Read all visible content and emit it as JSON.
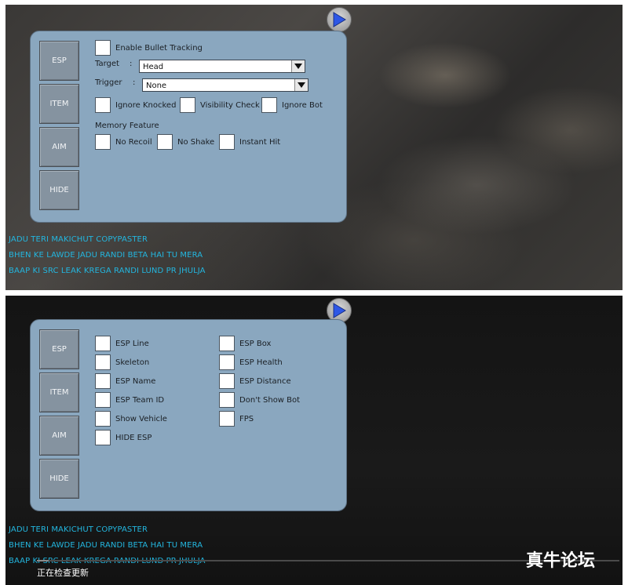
{
  "screens": [
    {
      "tabs": [
        "ESP",
        "ITEM",
        "AIM",
        "HIDE"
      ],
      "aim_panel": {
        "enable_bullet_tracking": "Enable Bullet Tracking",
        "target_label": "Target",
        "target_value": "Head",
        "trigger_label": "Trigger",
        "trigger_value": "None",
        "ignore_knocked": "Ignore Knocked",
        "visibility_check": "Visibility Check",
        "ignore_bot": "Ignore Bot",
        "memory_feature_label": "Memory Feature",
        "no_recoil": "No Recoil",
        "no_shake": "No Shake",
        "instant_hit": "Instant Hit"
      },
      "banner": [
        "JADU TERI MAKICHUT COPYPASTER",
        "BHEN KE LAWDE JADU RANDI BETA HAI TU MERA",
        "BAAP KI SRC LEAK KREGA RANDI LUND PR JHULJA"
      ]
    },
    {
      "tabs": [
        "ESP",
        "ITEM",
        "AIM",
        "HIDE"
      ],
      "esp_panel": {
        "left": [
          "ESP Line",
          "Skeleton",
          "ESP Name",
          "ESP Team ID",
          "Show Vehicle",
          "HIDE ESP"
        ],
        "right": [
          "ESP Box",
          "ESP Health",
          "ESP Distance",
          "Don't Show Bot",
          "FPS"
        ]
      },
      "banner": [
        "JADU TERI MAKICHUT COPYPASTER",
        "BHEN KE LAWDE JADU RANDI BETA HAI TU MERA",
        "BAAP KI SRC LEAK KREGA RANDI LUND PR JHULJA"
      ],
      "status_text": "正在检查更新",
      "progress_fraction": 0.02,
      "watermark": "真牛论坛"
    }
  ],
  "colors": {
    "panel_bg": "#8aa7bf",
    "tab_bg": "#8593a0",
    "banner_text": "#23b6df",
    "toggle_arrow": "#2e57e6"
  },
  "icons": {
    "toggle": "play-arrow-icon",
    "dropdown": "triangle-down-icon"
  }
}
